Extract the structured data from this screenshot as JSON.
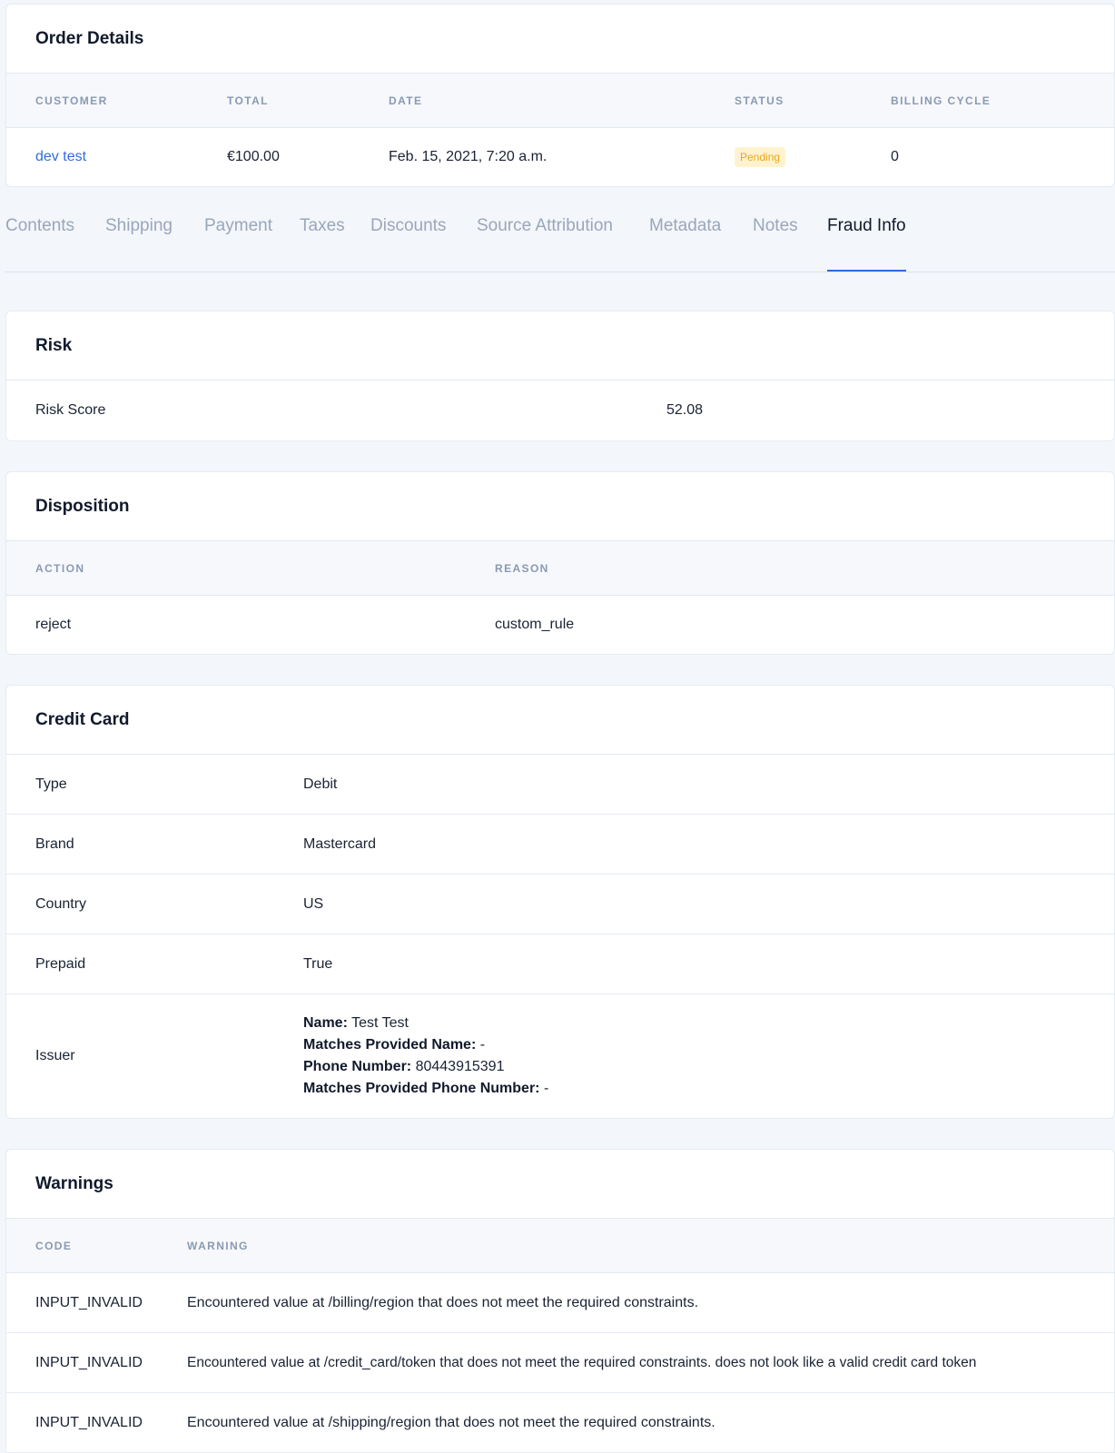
{
  "order": {
    "title": "Order Details",
    "columns": [
      "CUSTOMER",
      "TOTAL",
      "DATE",
      "STATUS",
      "BILLING CYCLE"
    ],
    "customer": "dev test",
    "total": "€100.00",
    "date": "Feb. 15, 2021, 7:20 a.m.",
    "status": "Pending",
    "billing_cycle": "0"
  },
  "tabs": [
    {
      "label": "Contents"
    },
    {
      "label": "Shipping"
    },
    {
      "label": "Payment"
    },
    {
      "label": "Taxes"
    },
    {
      "label": "Discounts"
    },
    {
      "label": "Source Attribution"
    },
    {
      "label": "Metadata"
    },
    {
      "label": "Notes"
    },
    {
      "label": "Fraud Info",
      "active": true
    }
  ],
  "risk": {
    "title": "Risk",
    "label": "Risk Score",
    "value": "52.08"
  },
  "disposition": {
    "title": "Disposition",
    "columns": [
      "ACTION",
      "REASON"
    ],
    "action": "reject",
    "reason": "custom_rule"
  },
  "credit_card": {
    "title": "Credit Card",
    "rows": [
      {
        "label": "Type",
        "value": "Debit"
      },
      {
        "label": "Brand",
        "value": "Mastercard"
      },
      {
        "label": "Country",
        "value": "US"
      },
      {
        "label": "Prepaid",
        "value": "True"
      }
    ],
    "issuer": {
      "label": "Issuer",
      "name_label": "Name:",
      "name_value": "Test Test",
      "matches_name_label": "Matches Provided Name:",
      "matches_name_value": "-",
      "phone_label": "Phone Number:",
      "phone_value": "80443915391",
      "matches_phone_label": "Matches Provided Phone Number:",
      "matches_phone_value": "-"
    }
  },
  "warnings": {
    "title": "Warnings",
    "columns": [
      "CODE",
      "WARNING"
    ],
    "rows": [
      {
        "code": "INPUT_INVALID",
        "warning": "Encountered value at /billing/region that does not meet the required constraints."
      },
      {
        "code": "INPUT_INVALID",
        "warning": "Encountered value at /credit_card/token that does not meet the required constraints. does not look like a valid credit card token"
      },
      {
        "code": "INPUT_INVALID",
        "warning": "Encountered value at /shipping/region that does not meet the required constraints."
      }
    ]
  },
  "colors": {
    "accent": "#2f6de1",
    "badge_bg": "#fff3cf",
    "badge_text": "#e6a91c",
    "muted": "#9aa7ba"
  }
}
